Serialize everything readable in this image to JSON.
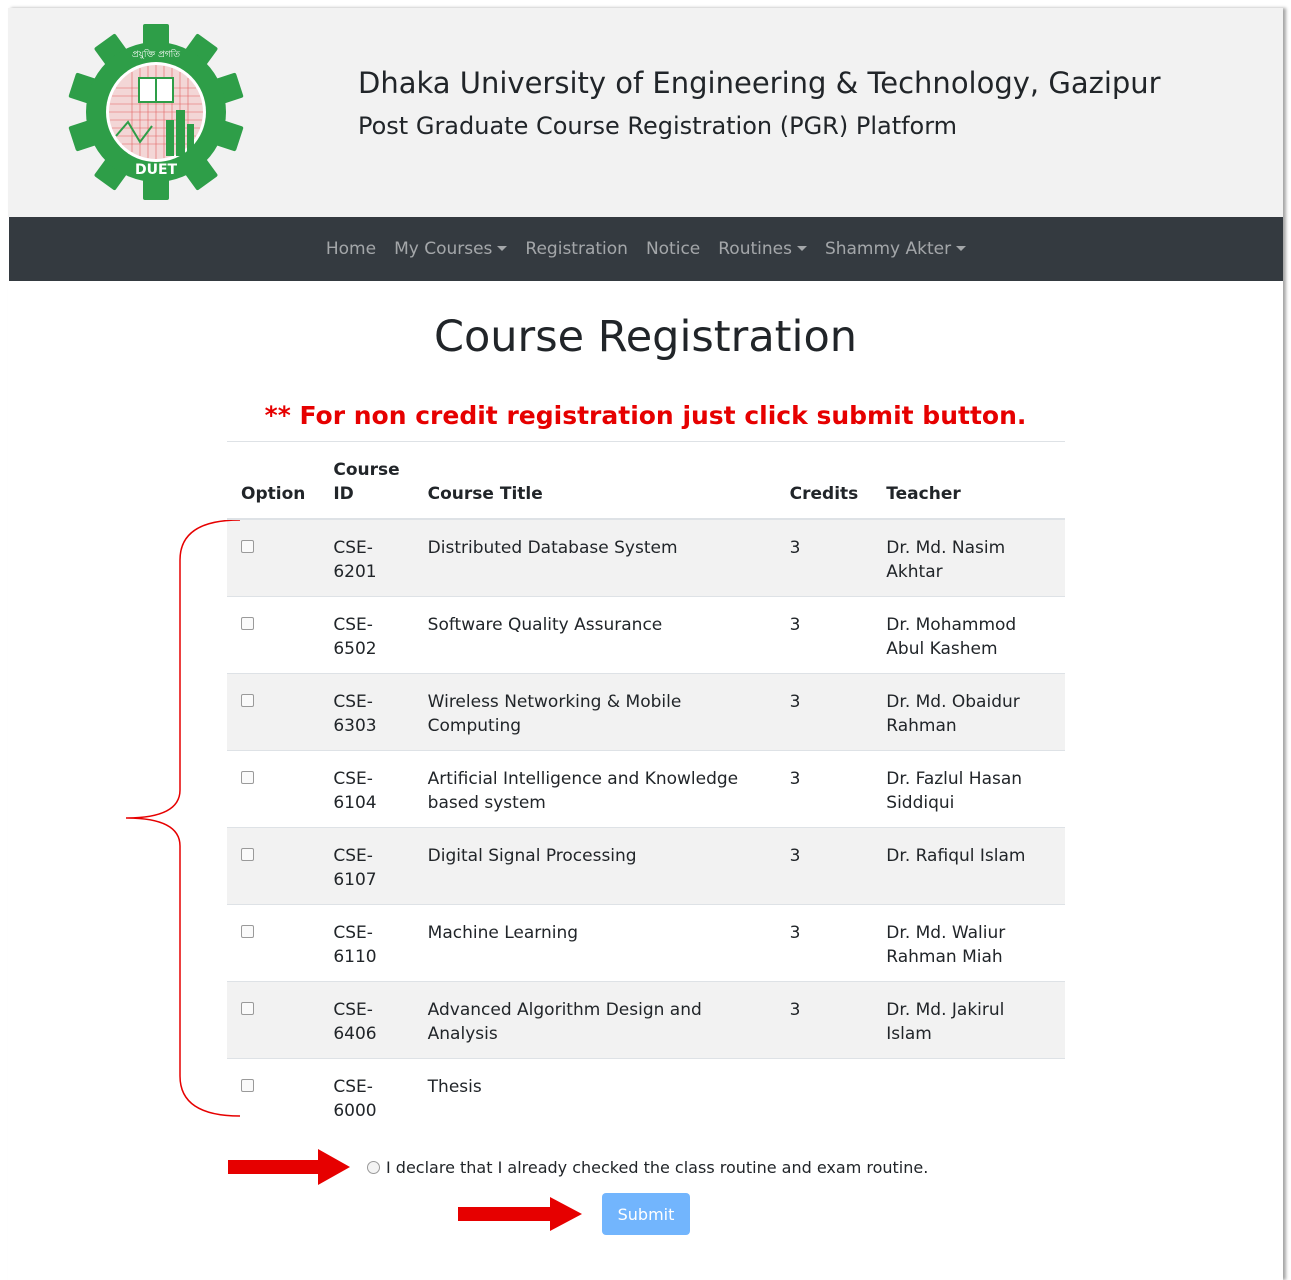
{
  "header": {
    "university": "Dhaka University of Engineering & Technology, Gazipur",
    "platform": "Post Graduate Course Registration (PGR) Platform",
    "logo_icon": "duet-gear-logo-icon",
    "logo_text": "DUET",
    "logo_motto": "প্রযুক্তি প্রগতি"
  },
  "nav": {
    "home": "Home",
    "my_courses": "My Courses",
    "registration": "Registration",
    "notice": "Notice",
    "routines": "Routines",
    "user": "Shammy Akter"
  },
  "page": {
    "title": "Course Registration",
    "notice": "** For non credit registration just click submit button."
  },
  "table": {
    "headers": {
      "option": "Option",
      "course_id": "Course ID",
      "course_title": "Course Title",
      "credits": "Credits",
      "teacher": "Teacher"
    },
    "rows": [
      {
        "id": "CSE-6201",
        "title": "Distributed Database System",
        "credits": "3",
        "teacher": "Dr. Md. Nasim Akhtar"
      },
      {
        "id": "CSE-6502",
        "title": "Software Quality Assurance",
        "credits": "3",
        "teacher": "Dr. Mohammod Abul Kashem"
      },
      {
        "id": "CSE-6303",
        "title": "Wireless Networking & Mobile Computing",
        "credits": "3",
        "teacher": "Dr. Md. Obaidur Rahman"
      },
      {
        "id": "CSE-6104",
        "title": "Artificial Intelligence and Knowledge based system",
        "credits": "3",
        "teacher": "Dr. Fazlul Hasan Siddiqui"
      },
      {
        "id": "CSE-6107",
        "title": "Digital Signal Processing",
        "credits": "3",
        "teacher": "Dr. Rafiqul Islam"
      },
      {
        "id": "CSE-6110",
        "title": "Machine Learning",
        "credits": "3",
        "teacher": "Dr. Md. Waliur Rahman Miah"
      },
      {
        "id": "CSE-6406",
        "title": "Advanced Algorithm Design and Analysis",
        "credits": "3",
        "teacher": "Dr. Md. Jakirul Islam"
      },
      {
        "id": "CSE-6000",
        "title": "Thesis",
        "credits": "",
        "teacher": ""
      }
    ]
  },
  "declaration": {
    "text": "I declare that I already checked the class routine and exam routine.",
    "checked": false
  },
  "submit": {
    "label": "Submit"
  },
  "colors": {
    "navbar": "#343a40",
    "header_bg": "#f2f2f2",
    "notice_red": "#e60000",
    "submit_bg": "#72b5fd",
    "annotation_red": "#e60000"
  }
}
